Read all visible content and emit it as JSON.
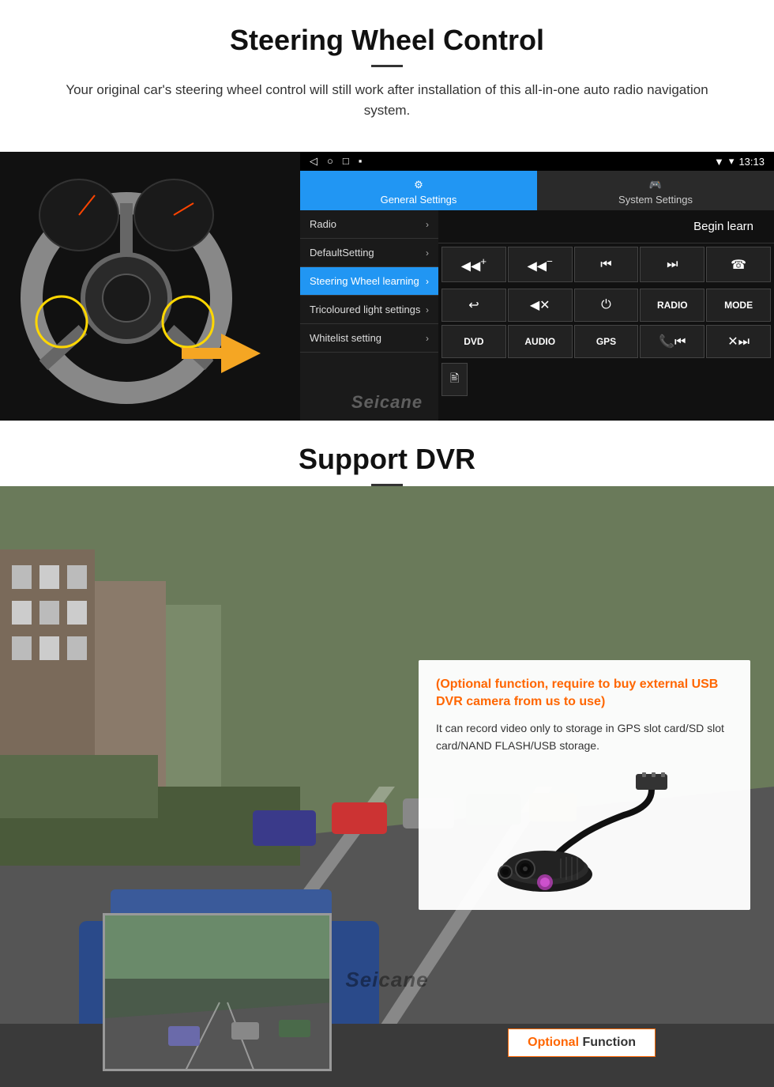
{
  "steering": {
    "title": "Steering Wheel Control",
    "description": "Your original car's steering wheel control will still work after installation of this all-in-one auto radio navigation system.",
    "status_bar": {
      "time": "13:13",
      "icons": [
        "◁",
        "○",
        "□",
        "▪"
      ]
    },
    "tabs": {
      "general": {
        "label": "General Settings",
        "icon": "⚙"
      },
      "system": {
        "label": "System Settings",
        "icon": "🎮"
      }
    },
    "menu_items": [
      {
        "label": "Radio",
        "active": false
      },
      {
        "label": "DefaultSetting",
        "active": false
      },
      {
        "label": "Steering Wheel learning",
        "active": true
      },
      {
        "label": "Tricoloured light settings",
        "active": false
      },
      {
        "label": "Whitelist setting",
        "active": false
      }
    ],
    "begin_learn": "Begin learn",
    "control_buttons_row1": [
      {
        "label": "◀◀+",
        "title": "vol-up"
      },
      {
        "label": "◀◀−",
        "title": "vol-down"
      },
      {
        "label": "⏮",
        "title": "prev-track"
      },
      {
        "label": "⏭",
        "title": "next-track"
      },
      {
        "label": "☎",
        "title": "phone"
      }
    ],
    "control_buttons_row2": [
      {
        "label": "↩",
        "title": "hangup"
      },
      {
        "label": "◀✕",
        "title": "mute"
      },
      {
        "label": "⏻",
        "title": "power"
      },
      {
        "label": "RADIO",
        "title": "radio",
        "text": true
      },
      {
        "label": "MODE",
        "title": "mode",
        "text": true
      }
    ],
    "control_buttons_row3": [
      {
        "label": "DVD",
        "title": "dvd",
        "text": true
      },
      {
        "label": "AUDIO",
        "title": "audio",
        "text": true
      },
      {
        "label": "GPS",
        "title": "gps",
        "text": true
      },
      {
        "label": "📞⏮",
        "title": "phone-prev"
      },
      {
        "label": "✕⏭",
        "title": "mute-next"
      }
    ],
    "whitelist_icon": "🖹",
    "seicane": "Seicane"
  },
  "dvr": {
    "title": "Support DVR",
    "optional_text": "(Optional function, require to buy external USB DVR camera from us to use)",
    "desc_text": "It can record video only to storage in GPS slot card/SD slot card/NAND FLASH/USB storage.",
    "badge": {
      "optional": "Optional",
      "function": " Function"
    },
    "seicane": "Seicane"
  }
}
